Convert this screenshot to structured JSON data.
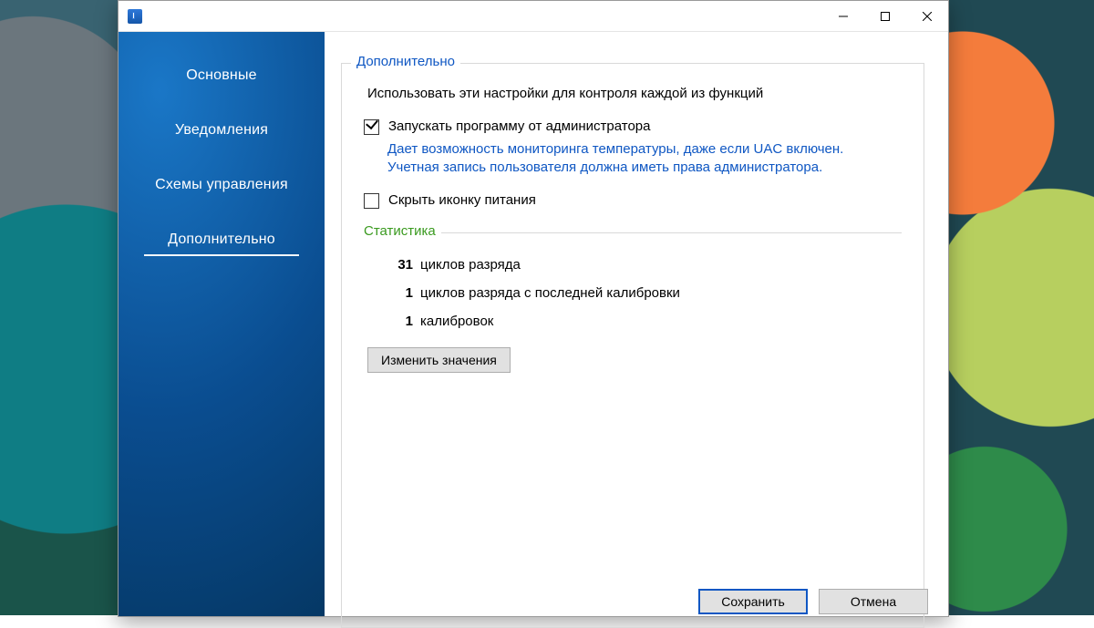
{
  "sidebar": {
    "items": [
      {
        "label": "Основные"
      },
      {
        "label": "Уведомления"
      },
      {
        "label": "Схемы управления"
      },
      {
        "label": "Дополнительно"
      }
    ],
    "selected_index": 3
  },
  "main": {
    "group_title": "Дополнительно",
    "description": "Использовать эти настройки для контроля каждой из функций",
    "run_as_admin": {
      "checked": true,
      "label": "Запускать программу от администратора",
      "hint": "Дает возможность мониторинга температуры, даже если UAC включен. Учетная запись пользователя должна иметь права администратора."
    },
    "hide_power_icon": {
      "checked": false,
      "label": "Скрыть иконку питания"
    },
    "stats": {
      "title": "Статистика",
      "rows": [
        {
          "value": "31",
          "label": "циклов разряда"
        },
        {
          "value": "1",
          "label": "циклов разряда с последней калибровки"
        },
        {
          "value": "1",
          "label": "калибровок"
        }
      ],
      "edit_button": "Изменить значения"
    }
  },
  "dialog_buttons": {
    "save": "Сохранить",
    "cancel": "Отмена"
  }
}
